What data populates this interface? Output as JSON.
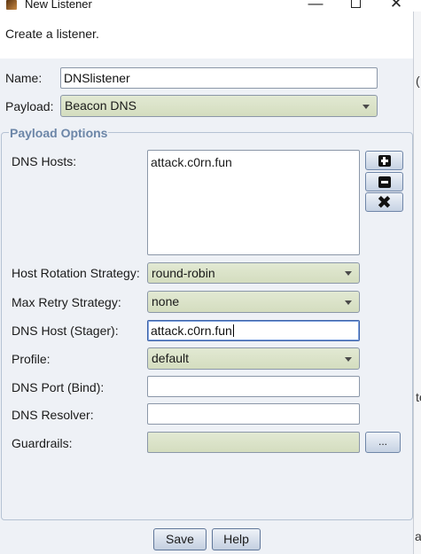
{
  "window": {
    "title": "New Listener"
  },
  "description": "Create a listener.",
  "form": {
    "name_label": "Name:",
    "name_value": "DNSlistener",
    "payload_label": "Payload:",
    "payload_value": "Beacon DNS"
  },
  "payload_options": {
    "title": "Payload Options",
    "dns_hosts_label": "DNS Hosts:",
    "dns_hosts": [
      "attack.c0rn.fun"
    ],
    "host_rotation_label": "Host Rotation Strategy:",
    "host_rotation_value": "round-robin",
    "max_retry_label": "Max Retry Strategy:",
    "max_retry_value": "none",
    "dns_host_stager_label": "DNS Host (Stager):",
    "dns_host_stager_value": "attack.c0rn.fun",
    "profile_label": "Profile:",
    "profile_value": "default",
    "dns_port_label": "DNS Port (Bind):",
    "dns_port_value": "",
    "dns_resolver_label": "DNS Resolver:",
    "dns_resolver_value": "",
    "guardrails_label": "Guardrails:",
    "guardrails_value": "",
    "browse_label": "..."
  },
  "buttons": {
    "save": "Save",
    "help": "Help"
  },
  "background_window_fragments": [
    "(",
    "te",
    "a"
  ],
  "icons": {
    "add_host": "plus-box-icon",
    "remove_host": "minus-box-icon",
    "clear_hosts": "x-icon"
  }
}
